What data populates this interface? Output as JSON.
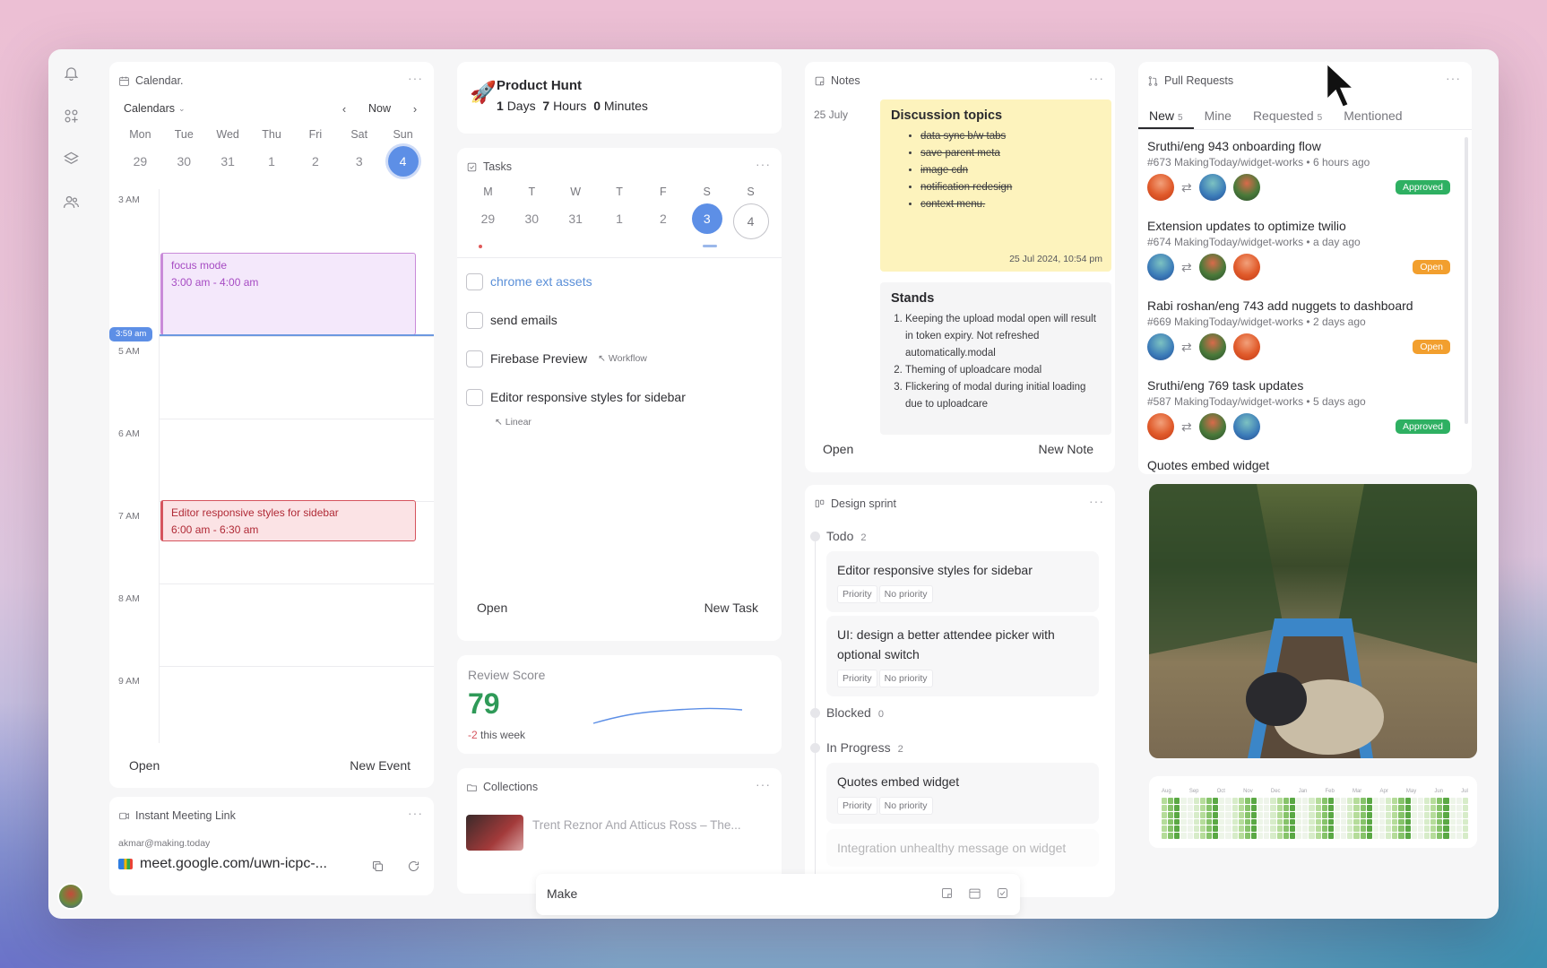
{
  "calendar": {
    "title": "Calendar.",
    "calendars_label": "Calendars",
    "now_label": "Now",
    "weekdays": [
      "Mon",
      "Tue",
      "Wed",
      "Thu",
      "Fri",
      "Sat",
      "Sun"
    ],
    "days": [
      "29",
      "30",
      "31",
      "1",
      "2",
      "3",
      "4"
    ],
    "hours": [
      "3 AM",
      "5 AM",
      "6 AM",
      "7 AM",
      "8 AM",
      "9 AM"
    ],
    "now_time": "3:59 am",
    "events": [
      {
        "title": "focus mode",
        "time": "3:00 am - 4:00 am"
      },
      {
        "title": "Editor responsive styles for sidebar",
        "time": "6:00 am - 6:30 am"
      }
    ],
    "open_label": "Open",
    "new_label": "New Event"
  },
  "producthunt": {
    "title": "Product Hunt",
    "days_n": "1",
    "days_label": "Days",
    "hours_n": "7",
    "hours_label": "Hours",
    "minutes_n": "0",
    "minutes_label": "Minutes"
  },
  "tasks": {
    "title": "Tasks",
    "weekdays": [
      "M",
      "T",
      "W",
      "T",
      "F",
      "S",
      "S"
    ],
    "days": [
      "29",
      "30",
      "31",
      "1",
      "2",
      "3",
      "4"
    ],
    "items": [
      {
        "label": "chrome ext assets",
        "tag": ""
      },
      {
        "label": "send emails",
        "tag": ""
      },
      {
        "label": "Firebase Preview",
        "tag": "Workflow"
      },
      {
        "label": "Editor responsive styles for sidebar",
        "tag": "Linear"
      }
    ],
    "open_label": "Open",
    "new_label": "New Task"
  },
  "review": {
    "title": "Review Score",
    "score": "79",
    "delta": "-2",
    "delta_label": "this week"
  },
  "collections": {
    "title": "Collections",
    "item": "Trent Reznor And Atticus Ross – The..."
  },
  "meeting": {
    "title": "Instant Meeting Link",
    "email": "akmar@making.today",
    "link": "meet.google.com/uwn-icpc-..."
  },
  "notes": {
    "title": "Notes",
    "date": "25 July",
    "sticky1": {
      "title": "Discussion topics",
      "items": [
        "data sync b/w tabs",
        "save parent meta",
        "image cdn",
        "notification redesign",
        "context menu."
      ],
      "timestamp": "25 Jul 2024, 10:54 pm"
    },
    "sticky2": {
      "title": "Stands",
      "items": [
        "Keeping the upload modal open will result in token expiry. Not refreshed automatically.modal",
        "Theming of uploadcare modal",
        "Flickering of modal during initial loading due to uploadcare"
      ]
    },
    "open_label": "Open",
    "new_label": "New Note"
  },
  "sprint": {
    "title": "Design sprint",
    "todo_label": "Todo",
    "todo_count": "2",
    "blocked_label": "Blocked",
    "blocked_count": "0",
    "progress_label": "In Progress",
    "progress_count": "2",
    "priority_label": "Priority",
    "no_priority_label": "No priority",
    "cards": [
      "Editor responsive styles for sidebar",
      "UI: design a better attendee picker with optional switch",
      "Quotes embed widget",
      "Integration unhealthy message on widget"
    ]
  },
  "prs": {
    "title": "Pull Requests",
    "tabs": [
      {
        "label": "New",
        "count": "5"
      },
      {
        "label": "Mine",
        "count": ""
      },
      {
        "label": "Requested",
        "count": "5"
      },
      {
        "label": "Mentioned",
        "count": ""
      }
    ],
    "items": [
      {
        "title": "Sruthi/eng 943 onboarding flow",
        "meta": "#673 MakingToday/widget-works • 6 hours ago",
        "status": "Approved"
      },
      {
        "title": "Extension updates to optimize twilio",
        "meta": "#674 MakingToday/widget-works • a day ago",
        "status": "Open"
      },
      {
        "title": "Rabi roshan/eng 743 add nuggets to dashboard",
        "meta": "#669 MakingToday/widget-works • 2 days ago",
        "status": "Open"
      },
      {
        "title": "Sruthi/eng 769 task updates",
        "meta": "#587 MakingToday/widget-works • 5 days ago",
        "status": "Approved"
      },
      {
        "title": "Quotes embed widget",
        "meta": "",
        "status": ""
      }
    ],
    "heatmap_months": [
      "Aug",
      "Sep",
      "Oct",
      "Nov",
      "Dec",
      "Jan",
      "Feb",
      "Mar",
      "Apr",
      "May",
      "Jun",
      "Jul"
    ]
  },
  "bottombar": {
    "input_label": "Make"
  },
  "colors": {
    "accent_blue": "#5d8fe6",
    "approved": "#2eb062",
    "open": "#f29f2e",
    "sticky_yellow": "#fdf3bd",
    "score_green": "#2f9a58"
  }
}
